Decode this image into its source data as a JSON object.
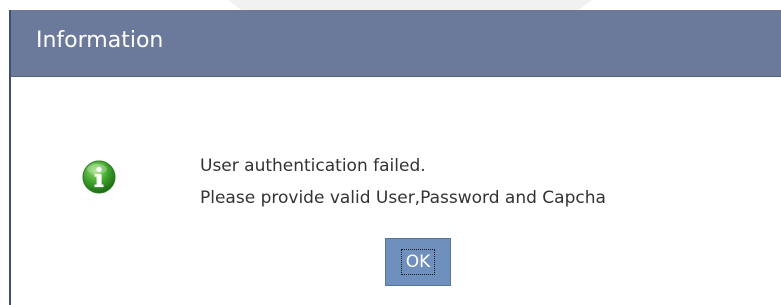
{
  "dialog": {
    "title": "Information",
    "icon": "info-icon",
    "message_lines": [
      "User authentication failed.",
      "Please provide valid User,Password and Capcha"
    ],
    "ok_label": "OK"
  },
  "colors": {
    "header": "#6b7a9a",
    "button": "#6f8fbd",
    "icon": "#3fa42c"
  }
}
